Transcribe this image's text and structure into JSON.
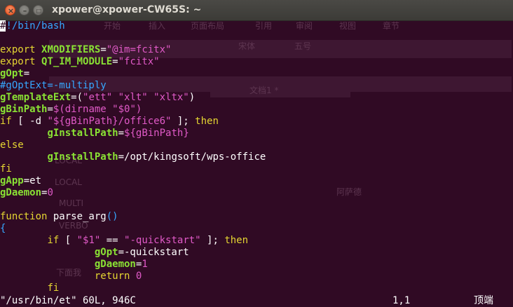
{
  "window": {
    "title": "xpower@xpower-CW65S: ~",
    "close_symbol": "×",
    "minimize_symbol": "–",
    "maximize_symbol": "□"
  },
  "background_app_ghost": {
    "tabs": [
      "开始",
      "插入",
      "页面布局",
      "引用",
      "审阅",
      "视图",
      "章节"
    ],
    "font_name": "宋体",
    "font_size": "五号",
    "document_tab": "文档1 *",
    "labels": [
      "LOCAL",
      "LOCAL",
      "MULTI",
      "VERBO",
      "阿萨德",
      "下面我"
    ]
  },
  "editor": {
    "lines": [
      [
        {
          "t": "#",
          "c": "cursor"
        },
        {
          "t": "!/bin/bash",
          "c": "c-cm"
        }
      ],
      [],
      [
        {
          "t": "export ",
          "c": "c-kw"
        },
        {
          "t": "XMODIFIERS",
          "c": "c-var"
        },
        {
          "t": "=",
          "c": ""
        },
        {
          "t": "\"@im=fcitx\"",
          "c": "c-str"
        }
      ],
      [
        {
          "t": "export ",
          "c": "c-kw"
        },
        {
          "t": "QT_IM_MODULE",
          "c": "c-var"
        },
        {
          "t": "=",
          "c": ""
        },
        {
          "t": "\"fcitx\"",
          "c": "c-str"
        }
      ],
      [
        {
          "t": "gOpt",
          "c": "c-var"
        },
        {
          "t": "=",
          "c": ""
        }
      ],
      [
        {
          "t": "#gOptExt=-multiply",
          "c": "c-cm"
        }
      ],
      [
        {
          "t": "gTemplateExt",
          "c": "c-var"
        },
        {
          "t": "=(",
          "c": ""
        },
        {
          "t": "\"ett\" \"xlt\" \"xltx\"",
          "c": "c-str"
        },
        {
          "t": ")",
          "c": ""
        }
      ],
      [
        {
          "t": "gBinPath",
          "c": "c-var"
        },
        {
          "t": "=",
          "c": ""
        },
        {
          "t": "$(dirname ",
          "c": "c-str"
        },
        {
          "t": "\"$0\"",
          "c": "c-str"
        },
        {
          "t": ")",
          "c": "c-str"
        }
      ],
      [
        {
          "t": "if",
          "c": "c-kw"
        },
        {
          "t": " [ -d ",
          "c": ""
        },
        {
          "t": "\"",
          "c": "c-str"
        },
        {
          "t": "${gBinPath}",
          "c": "c-str"
        },
        {
          "t": "/office6\"",
          "c": "c-str"
        },
        {
          "t": " ]; ",
          "c": ""
        },
        {
          "t": "then",
          "c": "c-kw"
        }
      ],
      [
        {
          "t": "        ",
          "c": ""
        },
        {
          "t": "gInstallPath",
          "c": "c-var"
        },
        {
          "t": "=",
          "c": ""
        },
        {
          "t": "${gBinPath}",
          "c": "c-str"
        }
      ],
      [
        {
          "t": "else",
          "c": "c-kw"
        }
      ],
      [
        {
          "t": "        ",
          "c": ""
        },
        {
          "t": "gInstallPath",
          "c": "c-var"
        },
        {
          "t": "=/opt/kingsoft/wps-office",
          "c": ""
        }
      ],
      [
        {
          "t": "fi",
          "c": "c-kw"
        }
      ],
      [
        {
          "t": "gApp",
          "c": "c-var"
        },
        {
          "t": "=et",
          "c": ""
        }
      ],
      [
        {
          "t": "gDaemon",
          "c": "c-var"
        },
        {
          "t": "=",
          "c": ""
        },
        {
          "t": "0",
          "c": "c-str"
        }
      ],
      [],
      [
        {
          "t": "function ",
          "c": "c-kw"
        },
        {
          "t": "parse_arg",
          "c": ""
        },
        {
          "t": "()",
          "c": "c-fn"
        }
      ],
      [
        {
          "t": "{",
          "c": "c-fn"
        }
      ],
      [
        {
          "t": "        ",
          "c": ""
        },
        {
          "t": "if",
          "c": "c-kw"
        },
        {
          "t": " [ ",
          "c": ""
        },
        {
          "t": "\"$1\"",
          "c": "c-str"
        },
        {
          "t": " == ",
          "c": ""
        },
        {
          "t": "\"-quickstart\"",
          "c": "c-str"
        },
        {
          "t": " ]; ",
          "c": ""
        },
        {
          "t": "then",
          "c": "c-kw"
        }
      ],
      [
        {
          "t": "                ",
          "c": ""
        },
        {
          "t": "gOpt",
          "c": "c-var"
        },
        {
          "t": "=-quickstart",
          "c": ""
        }
      ],
      [
        {
          "t": "                ",
          "c": ""
        },
        {
          "t": "gDaemon",
          "c": "c-var"
        },
        {
          "t": "=",
          "c": ""
        },
        {
          "t": "1",
          "c": "c-str"
        }
      ],
      [
        {
          "t": "                ",
          "c": ""
        },
        {
          "t": "return ",
          "c": "c-kw"
        },
        {
          "t": "0",
          "c": "c-str"
        }
      ],
      [
        {
          "t": "        ",
          "c": ""
        },
        {
          "t": "fi",
          "c": "c-kw"
        }
      ]
    ],
    "status": {
      "file_info": "\"/usr/bin/et\" 60L, 946C",
      "cursor_pos": "1,1",
      "scroll": "顶端"
    }
  }
}
